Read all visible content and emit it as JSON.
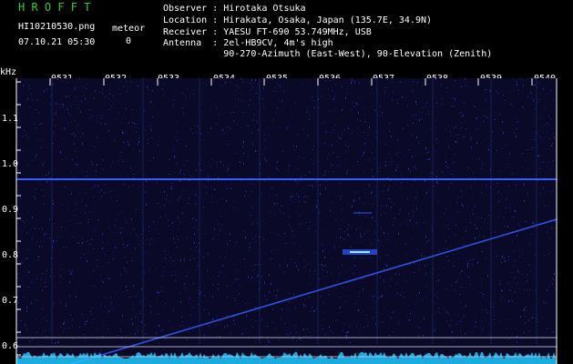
{
  "app_title": "H R O F F T",
  "colors": {
    "title": "#33cc33",
    "text": "#ffffff",
    "background": "#000000",
    "spectrum_bg": "#0a0a28",
    "signal": "#3a5cff",
    "echo": "#9fe8ff",
    "noise_floor": "#1ec8ff",
    "marker_lines": "#c8c8d8"
  },
  "file_name": "HI10210530.png",
  "meteor_label": "meteor",
  "meteor_count": "0",
  "timestamp": "07.10.21 05:30",
  "info": {
    "observer": "Observer : Hirotaka Otsuka",
    "location": "Location : Hirakata, Osaka, Japan (135.7E, 34.9N)",
    "receiver": "Receiver : YAESU FT-690 53.749MHz, USB",
    "antenna": "Antenna  : 2el-HB9CV, 4m's high",
    "antenna_detail": "           90-270-Azimuth (East-West), 90-Elevation (Zenith)"
  },
  "y_axis": {
    "unit": "kHz",
    "tick_labels": [
      "1.1",
      "1.0",
      "0.9",
      "0.8",
      "0.7",
      "0.6"
    ]
  },
  "x_axis": {
    "tick_labels": [
      "0531",
      "0532",
      "0533",
      "0534",
      "0535",
      "0536",
      "0537",
      "0538",
      "0539",
      "0540"
    ]
  },
  "icons": {
    "spectrogram": "spectrogram-display"
  }
}
